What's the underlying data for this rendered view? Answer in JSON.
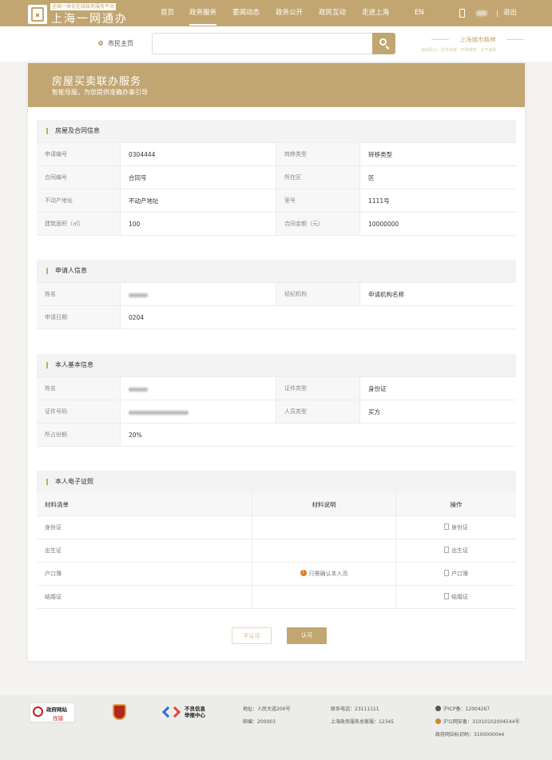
{
  "header": {
    "logo_tagline": "全国一体化在线政务服务平台",
    "logo_name": "上海一网通办",
    "nav": [
      "首页",
      "政务服务",
      "要闻动态",
      "政务公开",
      "政民互动",
      "走进上海",
      "EN"
    ],
    "active_nav": "政务服务",
    "logout": "退出"
  },
  "search": {
    "citizen_home": "市民主页",
    "placeholder": "",
    "brand_title": "上海城市精神",
    "brand_sub": "海纳百川 · 追求卓越 · 开明睿智 · 大气谦和"
  },
  "banner": {
    "title": "房屋买卖联办服务",
    "subtitle": "智能导服，为您提供准确办事引导"
  },
  "house_section": {
    "title": "房屋及合同信息",
    "rows": [
      [
        {
          "label": "申请编号",
          "value": "0304444"
        },
        {
          "label": "转移类型",
          "value": "转移类型"
        }
      ],
      [
        {
          "label": "合同编号",
          "value": "合同号"
        },
        {
          "label": "所在区",
          "value": "区"
        }
      ],
      [
        {
          "label": "不动产地址",
          "value": "不动产地址"
        },
        {
          "label": "室号",
          "value": "1111号"
        }
      ],
      [
        {
          "label": "建筑面积（㎡）",
          "value": "100"
        },
        {
          "label": "合同金额（元）",
          "value": "10000000"
        }
      ]
    ]
  },
  "applicant_section": {
    "title": "申请人信息",
    "name_label": "姓名",
    "agency_label": "经纪机构",
    "agency_value": "申请机构名称",
    "date_label": "申请日期",
    "date_value": "0204"
  },
  "personal_section": {
    "title": "本人基本信息",
    "name_label": "姓名",
    "id_type_label": "证件类型",
    "id_type_value": "身份证",
    "id_no_label": "证件号码",
    "person_type_label": "人员类型",
    "person_type_value": "买方",
    "share_label": "所占份额",
    "share_value": "20%"
  },
  "license_section": {
    "title": "本人电子证照",
    "columns": [
      "材料清单",
      "材料说明",
      "操作"
    ],
    "rows": [
      {
        "name": "身份证",
        "note": "",
        "action": "身份证"
      },
      {
        "name": "出生证",
        "note": "",
        "action": "出生证"
      },
      {
        "name": "户口簿",
        "note": "只需确认本人页",
        "action": "户口簿"
      },
      {
        "name": "结婚证",
        "note": "",
        "action": "结婚证"
      }
    ]
  },
  "actions": {
    "reject": "不认可",
    "accept": "认可"
  },
  "footer": {
    "gov_site_title": "政府网站",
    "gov_site_sub": "找错",
    "report_center": "不良信息举报中心",
    "address": "地址：人民大道200号",
    "postcode": "邮编：200003",
    "phone": "联系电话：23111111",
    "hotline": "上海政务服务总客服：12345",
    "icp": "沪ICP备：12004267",
    "police": "沪公网安备：31010102004544号",
    "site_code": "政府网站标识码：3100000044"
  },
  "colors": {
    "brand_gold": "#c2a671",
    "warning_orange": "#e07b28"
  }
}
